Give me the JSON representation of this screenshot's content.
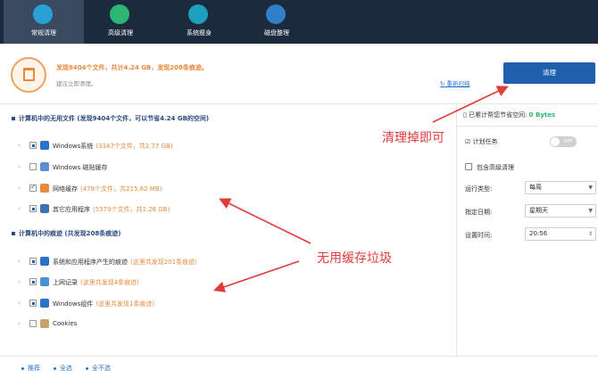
{
  "nav": {
    "items": [
      {
        "label": "常规清理",
        "icon": "broom-icon"
      },
      {
        "label": "高级清理",
        "icon": "advanced-clean-icon"
      },
      {
        "label": "系统瘦身",
        "icon": "windows-icon"
      },
      {
        "label": "磁盘整理",
        "icon": "disk-icon"
      }
    ],
    "active_index": 0
  },
  "summary": {
    "title": "发现9404个文件，共计4.24 GB，发现208条痕迹。",
    "subtitle": "建议立即清理。",
    "rescan": "重新扫描",
    "clean_button": "清理"
  },
  "sections": [
    {
      "title": "计算机中的无用文件 (发现9404个文件，可以节省4.24 GB的空间)",
      "rows": [
        {
          "label": "Windows系统",
          "detail": "(3347个文件，共2.77 GB)",
          "check": "partial",
          "icon_color": "#2a73c8"
        },
        {
          "label": "Windows 磁贴缓存",
          "detail": "",
          "check": "none",
          "icon_color": "#5a8fd0"
        },
        {
          "label": "网络缓存",
          "detail": "(478个文件，共215.62 MB)",
          "check": "checked",
          "icon_color": "#e98a3a"
        },
        {
          "label": "其它应用程序",
          "detail": "(5579个文件，共1.26 GB)",
          "check": "partial",
          "icon_color": "#3b6fb6"
        }
      ]
    },
    {
      "title": "计算机中的痕迹 (共发现208条痕迹)",
      "rows": [
        {
          "label": "系统和应用程序产生的痕迹",
          "detail": "(这里共发现201条痕迹)",
          "check": "partial",
          "icon_color": "#2a73c8"
        },
        {
          "label": "上网记录",
          "detail": "(这里共发现4条痕迹)",
          "check": "partial",
          "icon_color": "#4a90d9"
        },
        {
          "label": "Windows组件",
          "detail": "(这里共发现1条痕迹)",
          "check": "partial",
          "icon_color": "#2a73c8"
        },
        {
          "label": "Cookies",
          "detail": "",
          "check": "none",
          "icon_color": "#c9a36a"
        }
      ]
    }
  ],
  "right_panel": {
    "saved_label": "已累计帮您节省空间:",
    "saved_value": "0 Bytes",
    "schedule_label": "计划任务",
    "toggle_text": "OFF",
    "advanced_label": "包含高级清理",
    "run_type_label": "运行类型:",
    "run_type_value": "每周",
    "date_label": "指定日期:",
    "date_value": "星期天",
    "time_label": "设置时间:",
    "time_value": "20:56"
  },
  "bottom": {
    "links": [
      "推荐",
      "全选",
      "全不选"
    ]
  },
  "annotations": {
    "clean_note": "清理掉即可",
    "cache_note": "无用缓存垃圾"
  },
  "colors": {
    "accent": "#1e5fae",
    "warning": "#e98a3a",
    "annotation": "#e23b3b",
    "success": "#2bb673"
  }
}
